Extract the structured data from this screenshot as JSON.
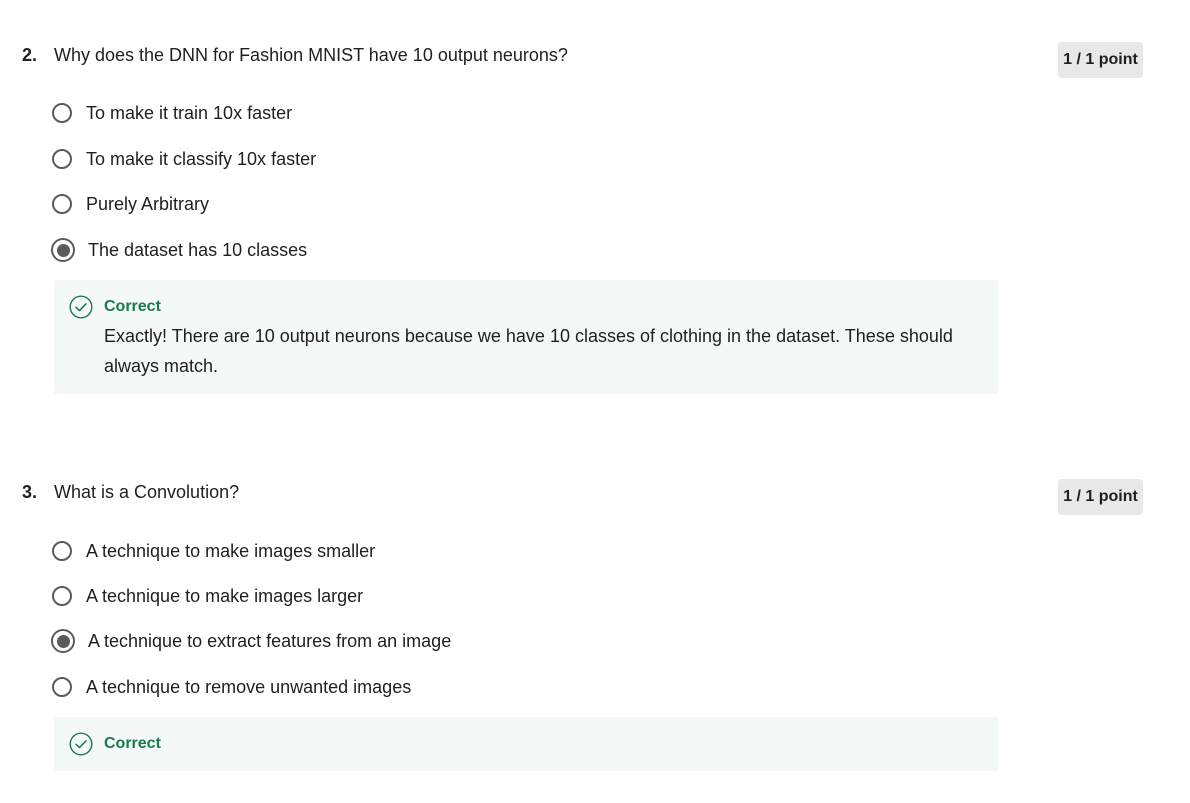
{
  "questions": [
    {
      "number": "2.",
      "text": "Why does the DNN for Fashion MNIST have 10 output neurons?",
      "points": "1 / 1 point",
      "options": [
        {
          "label": "To make it train 10x faster",
          "selected": false
        },
        {
          "label": "To make it classify 10x faster",
          "selected": false
        },
        {
          "label": "Purely Arbitrary",
          "selected": false
        },
        {
          "label": "The dataset has 10 classes",
          "selected": true
        }
      ],
      "feedback": {
        "status": "Correct",
        "icon": "check-circle-icon",
        "text": "Exactly! There are 10 output neurons because we have 10 classes of clothing in the dataset. These should always match."
      }
    },
    {
      "number": "3.",
      "text": "What is a Convolution?",
      "points": "1 / 1 point",
      "options": [
        {
          "label": "A technique to make images smaller",
          "selected": false
        },
        {
          "label": "A technique to make images larger",
          "selected": false
        },
        {
          "label": "A technique to extract features from an image",
          "selected": true
        },
        {
          "label": "A technique to remove unwanted images",
          "selected": false
        }
      ],
      "feedback": {
        "status": "Correct",
        "icon": "check-circle-icon",
        "text": ""
      }
    }
  ],
  "colors": {
    "correct_green": "#1a7a4d",
    "feedback_bg": "#f4f8f6",
    "points_badge_bg": "#e8e8e8",
    "radio_gray": "#5b5b5b"
  }
}
